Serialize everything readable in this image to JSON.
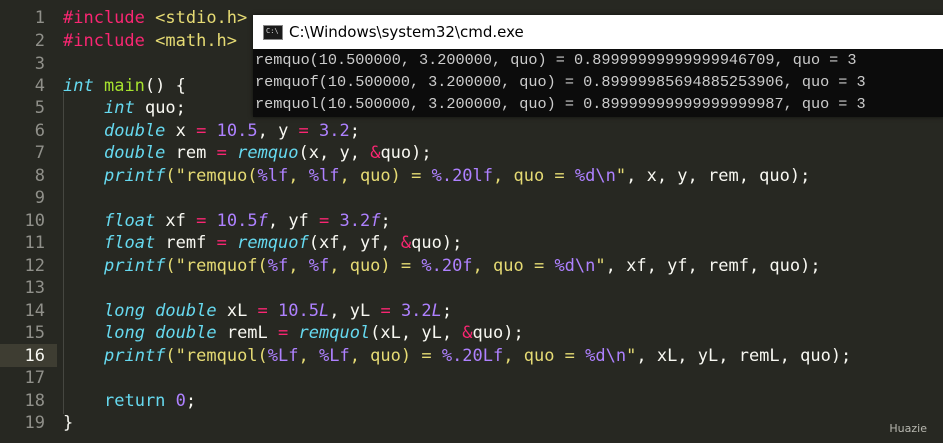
{
  "editor": {
    "line_numbers": [
      "1",
      "2",
      "3",
      "4",
      "5",
      "6",
      "7",
      "8",
      "9",
      "10",
      "11",
      "12",
      "13",
      "14",
      "15",
      "16",
      "17",
      "18",
      "19"
    ],
    "active_line": "16",
    "l1": {
      "directive": "#include",
      "path": "<stdio.h>"
    },
    "l2": {
      "directive": "#include",
      "path": "<math.h>"
    },
    "l4": {
      "type": "int",
      "name": "main",
      "rest": "() {"
    },
    "l5": {
      "type": "int",
      "rest": " quo;"
    },
    "l6": {
      "type": "double",
      "a": " x ",
      "eq1": "=",
      "n1": "10.5",
      "b": ", y ",
      "eq2": "=",
      "n2": "3.2",
      "end": ";"
    },
    "l7": {
      "type": "double",
      "a": " rem ",
      "eq": "=",
      "fn": "remquo",
      "b": "(x, y, ",
      "amp": "&",
      "end": "quo);"
    },
    "l8": {
      "fn": "printf",
      "s1": "(\"remquo(",
      "f1": "%lf",
      "s2": ", ",
      "f2": "%lf",
      "s3": ", quo) = ",
      "f3": "%.20lf",
      "s4": ", quo = ",
      "f4": "%d",
      "f5": "\\n",
      "s5": "\"",
      "end": ", x, y, rem, quo);"
    },
    "l10": {
      "type": "float",
      "a": " xf ",
      "eq1": "=",
      "n1": "10.5",
      "x1": "f",
      "b": ", yf ",
      "eq2": "=",
      "n2": "3.2",
      "x2": "f",
      "end": ";"
    },
    "l11": {
      "type": "float",
      "a": " remf ",
      "eq": "=",
      "fn": "remquof",
      "b": "(xf, yf, ",
      "amp": "&",
      "end": "quo);"
    },
    "l12": {
      "fn": "printf",
      "s1": "(\"remquof(",
      "f1": "%f",
      "s2": ", ",
      "f2": "%f",
      "s3": ", quo) = ",
      "f3": "%.20f",
      "s4": ", quo = ",
      "f4": "%d",
      "f5": "\\n",
      "s5": "\"",
      "end": ", xf, yf, remf, quo);"
    },
    "l14": {
      "type": "long double",
      "a": " xL ",
      "eq1": "=",
      "n1": "10.5",
      "x1": "L",
      "b": ", yL ",
      "eq2": "=",
      "n2": "3.2",
      "x2": "L",
      "end": ";"
    },
    "l15": {
      "type": "long double",
      "a": " remL ",
      "eq": "=",
      "fn": "remquol",
      "b": "(xL, yL, ",
      "amp": "&",
      "end": "quo);"
    },
    "l16": {
      "fn": "printf",
      "s1": "(\"remquol(",
      "f1": "%Lf",
      "s2": ", ",
      "f2": "%Lf",
      "s3": ", quo) = ",
      "f3": "%.20Lf",
      "s4": ", quo = ",
      "f4": "%d",
      "f5": "\\n",
      "s5": "\"",
      "end": ", xL, yL, remL, quo);"
    },
    "l18": {
      "kw": "return",
      "sp": " ",
      "n": "0",
      "end": ";"
    },
    "l19": {
      "text": "}"
    }
  },
  "console": {
    "title": "C:\\Windows\\system32\\cmd.exe",
    "icon_label": "C:\\",
    "lines": [
      "remquo(10.500000, 3.200000, quo) = 0.89999999999999946709, quo = 3",
      "remquof(10.500000, 3.200000, quo) = 0.89999985694885253906, quo = 3",
      "remquol(10.500000, 3.200000, quo) = 0.89999999999999999987, quo = 3"
    ]
  },
  "watermark": "Huazie",
  "colors": {
    "background": "#272822",
    "keyword": "#66d9ef",
    "operator": "#f92672",
    "string": "#e6db74",
    "number": "#ae81ff",
    "function_def": "#a6e22e"
  }
}
